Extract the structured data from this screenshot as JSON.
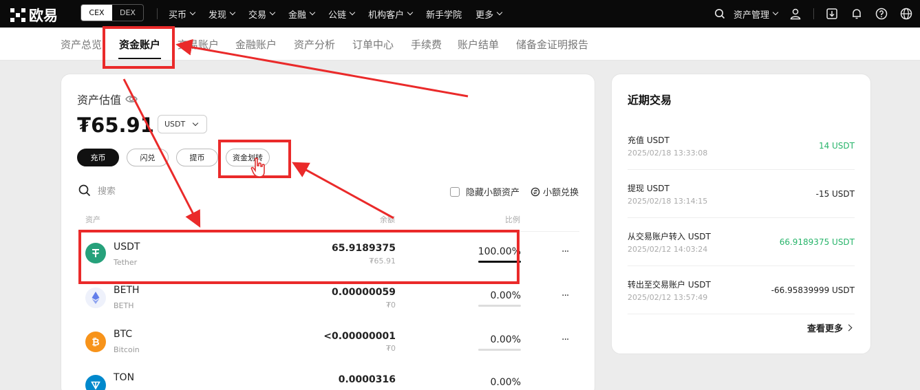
{
  "logo": {
    "text": "欧易"
  },
  "header": {
    "segment": [
      "CEX",
      "DEX"
    ],
    "nav": [
      "买币",
      "发现",
      "交易",
      "金融",
      "公链",
      "机构客户",
      "新手学院",
      "更多"
    ],
    "asset_mgmt": "资产管理"
  },
  "subtabs": [
    "资产总览",
    "资金账户",
    "交易账户",
    "金融账户",
    "资产分析",
    "订单中心",
    "手续费",
    "账户结单",
    "储备金证明报告"
  ],
  "summary": {
    "label": "资产估值",
    "balance": "₮65.91",
    "unit": "USDT",
    "buttons": [
      "充币",
      "闪兑",
      "提币",
      "资金划转"
    ]
  },
  "filters": {
    "search_placeholder": "搜索",
    "hide_small": "隐藏小额资产",
    "small_exchange": "小额兑换"
  },
  "table": {
    "headers": [
      "资产",
      "余额",
      "比例"
    ],
    "rows": [
      {
        "symbol": "USDT",
        "name": "Tether",
        "amount": "65.9189375",
        "value": "₮65.91",
        "pct": "100.00%",
        "pct_fill": 1.0,
        "color": "#26a17b",
        "icon": "T"
      },
      {
        "symbol": "BETH",
        "name": "BETH",
        "amount": "0.00000059",
        "value": "₮0",
        "pct": "0.00%",
        "pct_fill": 0,
        "color": "#627eea",
        "icon": "eth"
      },
      {
        "symbol": "BTC",
        "name": "Bitcoin",
        "amount": "<0.00000001",
        "value": "₮0",
        "pct": "0.00%",
        "pct_fill": 0,
        "color": "#f7931a",
        "icon": "B"
      },
      {
        "symbol": "TON",
        "name": "",
        "amount": "0.0000316",
        "value": "",
        "pct": "0.00%",
        "pct_fill": 0,
        "color": "#0088cc",
        "icon": "ton"
      }
    ]
  },
  "recent": {
    "title": "近期交易",
    "items": [
      {
        "title": "充值 USDT",
        "time": "2025/02/18 13:33:08",
        "amount": "14 USDT",
        "positive": true
      },
      {
        "title": "提现 USDT",
        "time": "2025/02/18 13:14:15",
        "amount": "-15 USDT",
        "positive": false
      },
      {
        "title": "从交易账户转入 USDT",
        "time": "2025/02/12 14:03:24",
        "amount": "66.9189375 USDT",
        "positive": true
      },
      {
        "title": "转出至交易账户 USDT",
        "time": "2025/02/12 13:57:49",
        "amount": "-66.95839999 USDT",
        "positive": false
      }
    ],
    "see_more": "查看更多"
  },
  "colors": {
    "annotation_red": "#ea2a2a",
    "positive_green": "#27b46a"
  }
}
